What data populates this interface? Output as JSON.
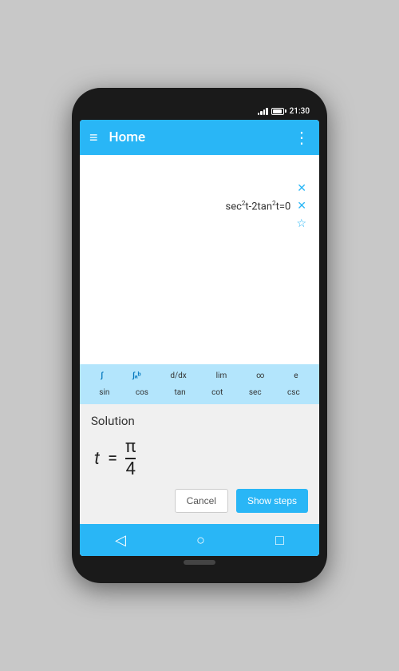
{
  "status_bar": {
    "time": "21:30"
  },
  "app_bar": {
    "title": "Home",
    "hamburger": "≡",
    "more": "⋮"
  },
  "equations": [
    {
      "text": "sec²t-2tan²t=0",
      "has_delete": true,
      "has_star": false
    }
  ],
  "keyboard": {
    "row1": [
      "∫",
      "∫ᵃᵇ",
      "d/dx",
      "lim",
      "∞",
      "e"
    ],
    "row2": [
      "sin",
      "cos",
      "tan",
      "cot",
      "sec",
      "csc"
    ]
  },
  "solution": {
    "label": "Solution",
    "variable": "t",
    "equals": "=",
    "numerator": "π",
    "denominator": "4"
  },
  "buttons": {
    "cancel": "Cancel",
    "show_steps": "Show steps"
  },
  "nav": {
    "back": "◁",
    "home": "○",
    "recent": "□"
  }
}
